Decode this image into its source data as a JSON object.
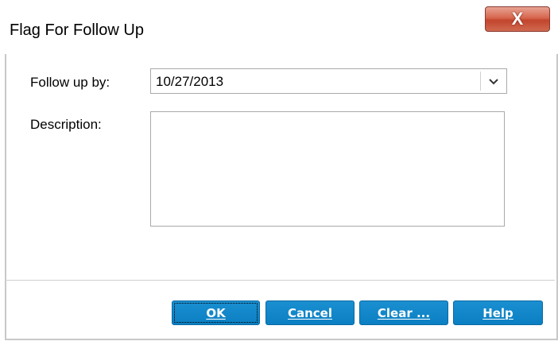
{
  "window": {
    "title": "Flag For Follow Up",
    "close_glyph": "X"
  },
  "form": {
    "follow_up_label": "Follow up by:",
    "follow_up_value": "10/27/2013",
    "description_label": "Description:",
    "description_value": ""
  },
  "buttons": {
    "ok": "OK",
    "cancel": "Cancel",
    "clear": "Clear ...",
    "help": "Help"
  },
  "icons": {
    "dropdown": "chevron-down-icon",
    "close": "close-icon"
  },
  "colors": {
    "button_blue": "#0b7fc3",
    "close_red": "#c2452d"
  }
}
